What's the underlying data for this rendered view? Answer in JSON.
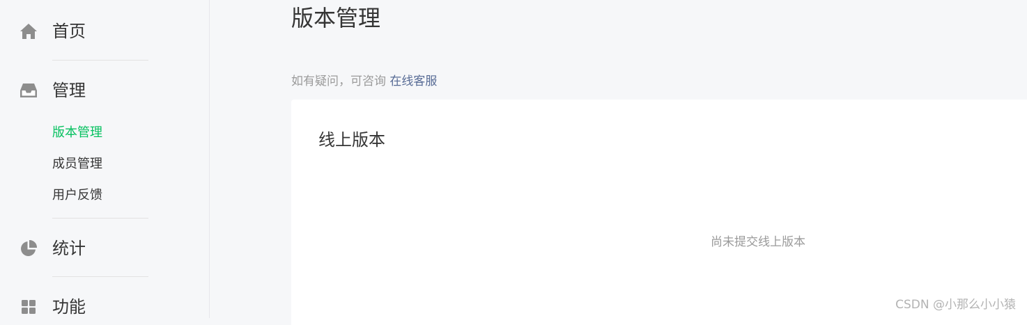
{
  "sidebar": {
    "items": [
      {
        "label": "首页",
        "icon": "home-icon"
      },
      {
        "label": "管理",
        "icon": "inbox-icon",
        "children": [
          {
            "label": "版本管理",
            "active": true
          },
          {
            "label": "成员管理",
            "active": false
          },
          {
            "label": "用户反馈",
            "active": false
          }
        ]
      },
      {
        "label": "统计",
        "icon": "pie-chart-icon"
      },
      {
        "label": "功能",
        "icon": "grid-icon"
      }
    ]
  },
  "main": {
    "title": "版本管理",
    "help_text": "如有疑问，可咨询",
    "help_link": "在线客服",
    "card": {
      "title": "线上版本",
      "empty_text": "尚未提交线上版本"
    }
  },
  "watermark": "CSDN @小那么小小猿",
  "colors": {
    "active": "#07c160",
    "link": "#576b95",
    "icon": "#8d8d8d",
    "background": "#f6f7f9"
  }
}
